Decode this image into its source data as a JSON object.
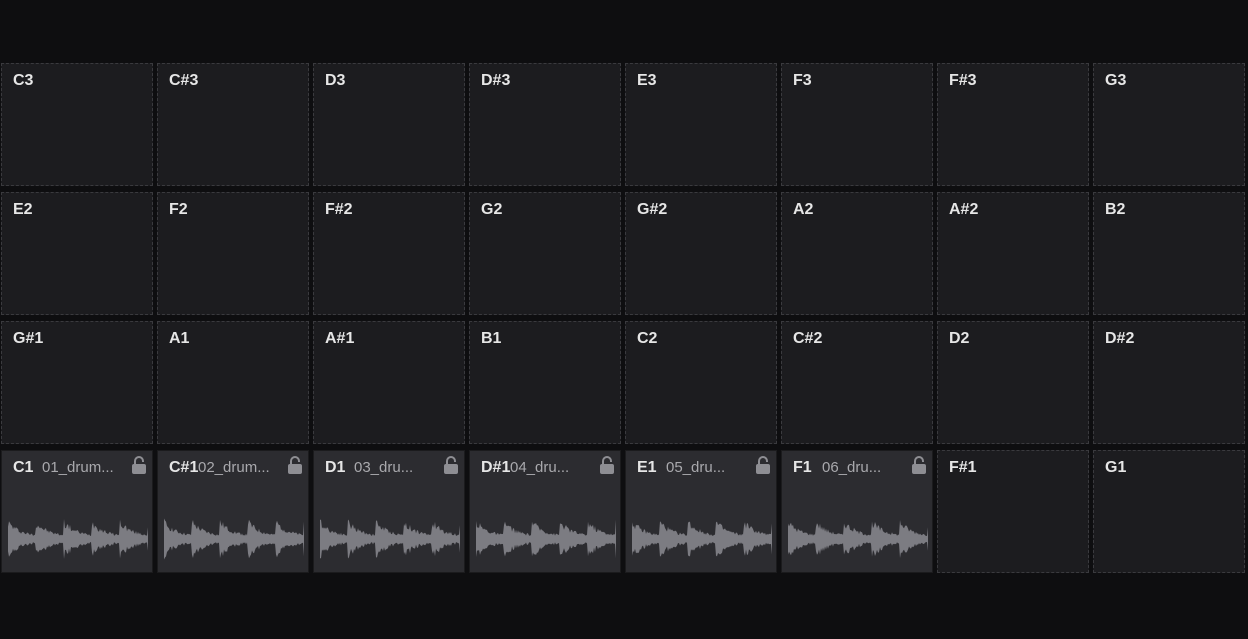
{
  "pad_rows": [
    [
      {
        "note": "C3"
      },
      {
        "note": "C#3"
      },
      {
        "note": "D3"
      },
      {
        "note": "D#3"
      },
      {
        "note": "E3"
      },
      {
        "note": "F3"
      },
      {
        "note": "F#3"
      },
      {
        "note": "G3"
      }
    ],
    [
      {
        "note": "E2"
      },
      {
        "note": "F2"
      },
      {
        "note": "F#2"
      },
      {
        "note": "G2"
      },
      {
        "note": "G#2"
      },
      {
        "note": "A2"
      },
      {
        "note": "A#2"
      },
      {
        "note": "B2"
      }
    ],
    [
      {
        "note": "G#1"
      },
      {
        "note": "A1"
      },
      {
        "note": "A#1"
      },
      {
        "note": "B1"
      },
      {
        "note": "C2"
      },
      {
        "note": "C#2"
      },
      {
        "note": "D2"
      },
      {
        "note": "D#2"
      }
    ],
    [
      {
        "note": "C1",
        "sample": "01_drum...",
        "icon": "unlock-icon"
      },
      {
        "note": "C#1",
        "sample": "02_drum...",
        "icon": "unlock-icon"
      },
      {
        "note": "D1",
        "sample": "03_dru...",
        "icon": "unlock-icon"
      },
      {
        "note": "D#1",
        "sample": "04_dru...",
        "icon": "unlock-icon"
      },
      {
        "note": "E1",
        "sample": "05_dru...",
        "icon": "unlock-icon"
      },
      {
        "note": "F1",
        "sample": "06_dru...",
        "icon": "unlock-icon"
      },
      {
        "note": "F#1"
      },
      {
        "note": "G1"
      }
    ]
  ],
  "colors": {
    "background": "#0e0e10",
    "empty_pad": "#1c1c1f",
    "loaded_pad": "#2c2c30",
    "waveform": "#7c7c82",
    "note_text": "#e6e6e6",
    "sample_text": "#a9a9ad",
    "lock_icon": "#8e8e93"
  }
}
